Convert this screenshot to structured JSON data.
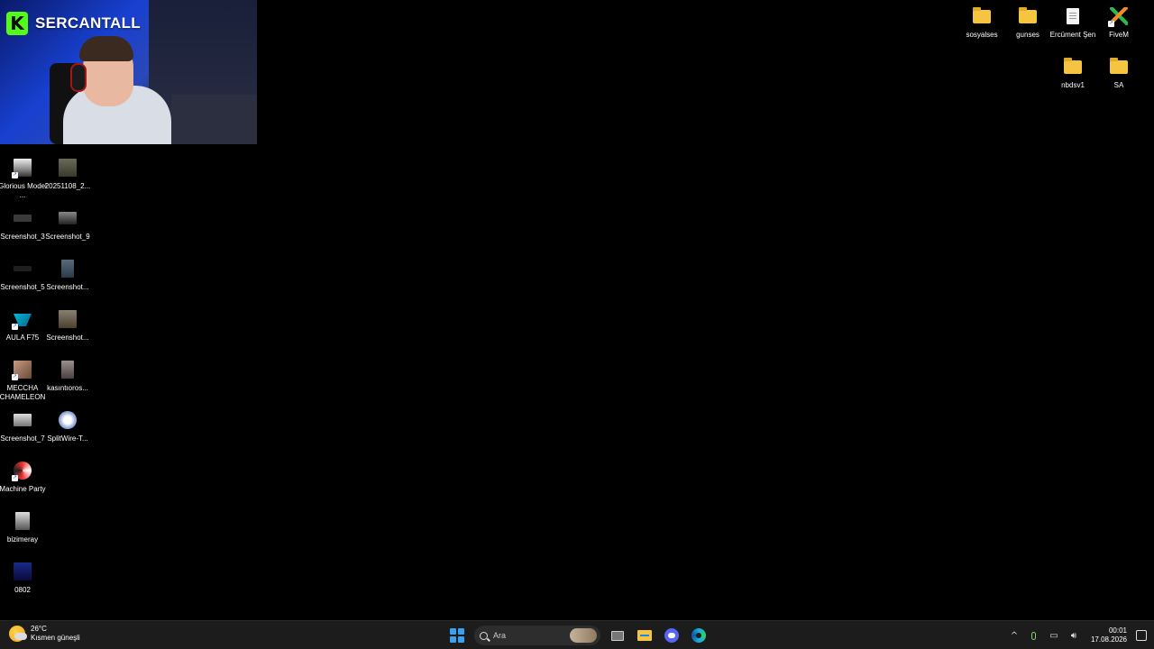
{
  "overlay": {
    "channel_logo": "K",
    "channel_name": "SERCANTALL",
    "accent": "#53fc18"
  },
  "desktop": {
    "left_icons": [
      {
        "label": "Glorious Model ...",
        "icon": "glorious-app-icon",
        "shortcut": true
      },
      {
        "label": "20251108_2...",
        "icon": "image-thumbnail-icon",
        "shortcut": false
      },
      {
        "label": "Screenshot_3",
        "icon": "image-thumbnail-icon",
        "shortcut": false
      },
      {
        "label": "Screenshot_9",
        "icon": "image-thumbnail-icon",
        "shortcut": false
      },
      {
        "label": "Screenshot_5",
        "icon": "image-thumbnail-icon",
        "shortcut": false
      },
      {
        "label": "Screenshot...",
        "icon": "image-thumbnail-icon",
        "shortcut": false
      },
      {
        "label": "AULA F75",
        "icon": "aula-app-icon",
        "shortcut": true
      },
      {
        "label": "Screenshot...",
        "icon": "image-thumbnail-icon",
        "shortcut": false
      },
      {
        "label": "MECCHA CHAMELEON",
        "icon": "game-icon",
        "shortcut": true
      },
      {
        "label": "kasıntıoros...",
        "icon": "image-thumbnail-icon",
        "shortcut": false
      },
      {
        "label": "Screenshot_7",
        "icon": "image-thumbnail-icon",
        "shortcut": false
      },
      {
        "label": "SplitWire-T...",
        "icon": "splitwire-icon",
        "shortcut": false
      },
      {
        "label": "Machine Party",
        "icon": "machine-party-icon",
        "shortcut": true
      },
      {
        "label": "bizimeray",
        "icon": "image-thumbnail-icon",
        "shortcut": false
      },
      {
        "label": "0802",
        "icon": "image-thumbnail-icon",
        "shortcut": false
      }
    ],
    "right_icons": [
      {
        "label": "sosyalses",
        "icon": "folder-icon"
      },
      {
        "label": "gunses",
        "icon": "folder-icon"
      },
      {
        "label": "Ercüment Şen",
        "icon": "document-icon"
      },
      {
        "label": "FiveM",
        "icon": "fivem-icon"
      },
      {
        "label": "nbdsv1",
        "icon": "folder-icon"
      },
      {
        "label": "SA",
        "icon": "folder-icon"
      }
    ]
  },
  "taskbar": {
    "weather": {
      "temp": "26°C",
      "condition": "Kısmen güneşli",
      "icon": "partly-sunny-icon"
    },
    "search_placeholder": "Ara",
    "apps": [
      {
        "name": "start-button",
        "icon": "windows-icon"
      },
      {
        "name": "task-view",
        "icon": "task-view-icon"
      },
      {
        "name": "file-explorer",
        "icon": "folder-icon"
      },
      {
        "name": "discord",
        "icon": "discord-icon"
      },
      {
        "name": "edge",
        "icon": "edge-icon"
      }
    ],
    "tray": {
      "overflow": "^",
      "time": "00:01",
      "date": "17.08.2026"
    }
  }
}
